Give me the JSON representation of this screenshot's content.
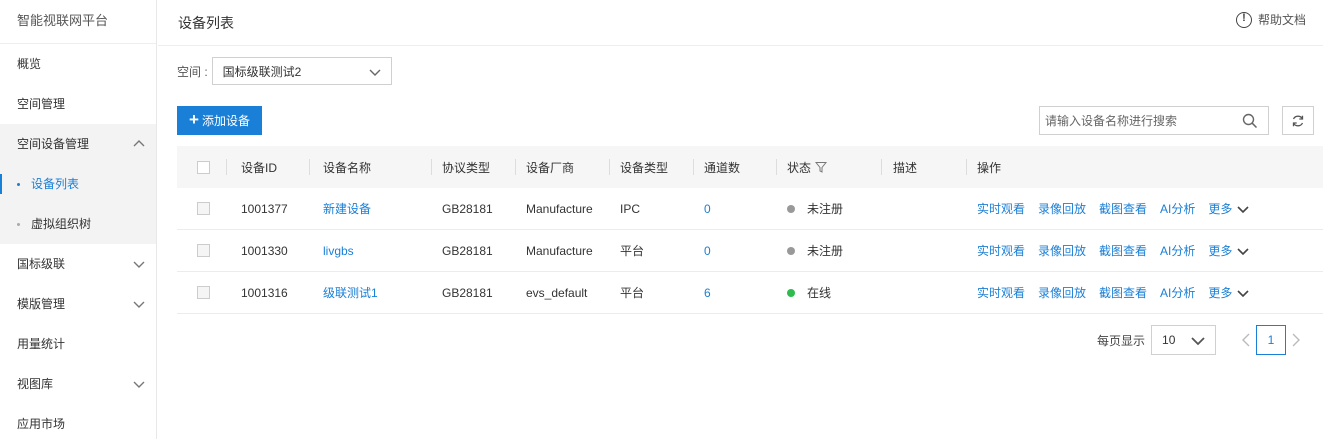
{
  "sidebar": {
    "brand": "智能视联网平台",
    "items": [
      {
        "label": "概览"
      },
      {
        "label": "空间管理"
      },
      {
        "label": "空间设备管理"
      },
      {
        "label": "设备列表"
      },
      {
        "label": "虚拟组织树"
      },
      {
        "label": "国标级联"
      },
      {
        "label": "模版管理"
      },
      {
        "label": "用量统计"
      },
      {
        "label": "视图库"
      },
      {
        "label": "应用市场"
      }
    ]
  },
  "header": {
    "title": "设备列表",
    "help_label": "帮助文档"
  },
  "space": {
    "label": "空间 :",
    "selected": "国标级联测试2"
  },
  "toolbar": {
    "add_label": "添加设备",
    "search_placeholder": "请输入设备名称进行搜索"
  },
  "table": {
    "headers": [
      "设备ID",
      "设备名称",
      "协议类型",
      "设备厂商",
      "设备类型",
      "通道数",
      "状态",
      "描述",
      "操作"
    ],
    "rows": [
      {
        "id": "1001377",
        "name": "新建设备",
        "protocol": "GB28181",
        "vendor": "Manufacture",
        "type": "IPC",
        "channels": "0",
        "status": "未注册",
        "status_color": "#999999",
        "description": ""
      },
      {
        "id": "1001330",
        "name": "livgbs",
        "protocol": "GB28181",
        "vendor": "Manufacture",
        "type": "平台",
        "channels": "0",
        "status": "未注册",
        "status_color": "#999999",
        "description": ""
      },
      {
        "id": "1001316",
        "name": "级联测试1",
        "protocol": "GB28181",
        "vendor": "evs_default",
        "type": "平台",
        "channels": "6",
        "status": "在线",
        "status_color": "#2ebc4f",
        "description": ""
      }
    ],
    "actions": [
      "实时观看",
      "录像回放",
      "截图查看",
      "AI分析",
      "更多"
    ]
  },
  "pagination": {
    "page_size_label": "每页显示",
    "page_size": "10",
    "current_page": "1"
  },
  "colors": {
    "accent": "#1a7fd6",
    "online": "#2ebc4f",
    "offline": "#999999"
  }
}
